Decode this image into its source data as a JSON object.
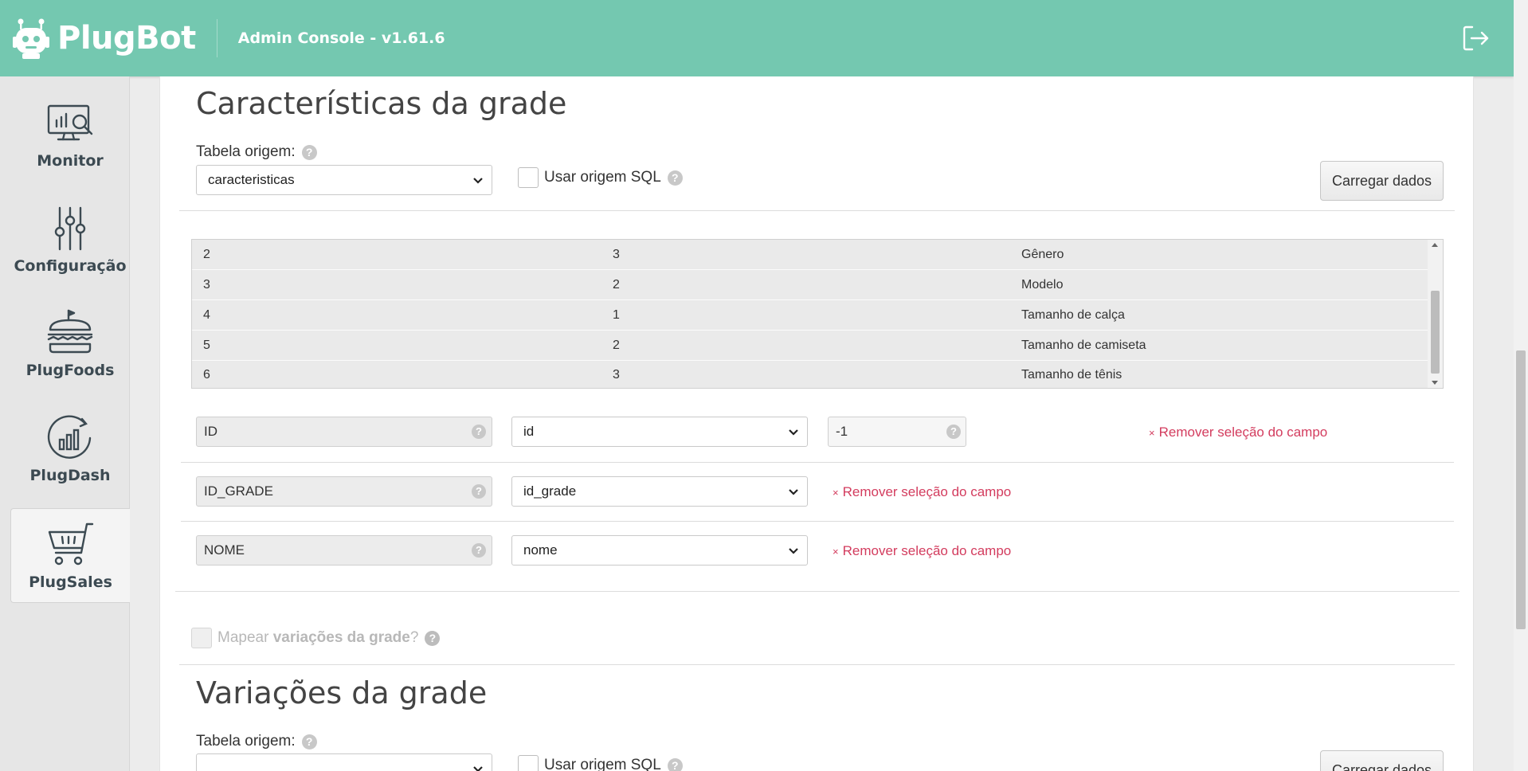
{
  "header": {
    "app_name": "PlugBot",
    "title": "Admin Console - v1.61.6",
    "logo_icon": "robot-icon",
    "logout_icon": "logout-icon"
  },
  "sidebar": {
    "items": [
      {
        "label": "Monitor",
        "icon": "monitor-icon"
      },
      {
        "label": "Configuração",
        "icon": "sliders-icon"
      },
      {
        "label": "PlugFoods",
        "icon": "burger-icon"
      },
      {
        "label": "PlugDash",
        "icon": "chart-icon"
      },
      {
        "label": "PlugSales",
        "icon": "cart-icon",
        "active": true
      }
    ]
  },
  "caracteristicas": {
    "title": "Características da grade",
    "tabela_label": "Tabela origem:",
    "tabela_value": "caracteristicas",
    "sql_label": "Usar origem SQL",
    "load_button": "Carregar dados",
    "rows": [
      {
        "c1": "2",
        "c2": "3",
        "c3": "Gênero"
      },
      {
        "c1": "3",
        "c2": "2",
        "c3": "Modelo"
      },
      {
        "c1": "4",
        "c2": "1",
        "c3": "Tamanho de calça"
      },
      {
        "c1": "5",
        "c2": "2",
        "c3": "Tamanho de camiseta"
      },
      {
        "c1": "6",
        "c2": "3",
        "c3": "Tamanho de tênis"
      }
    ],
    "fields": [
      {
        "name": "ID",
        "select": "id",
        "default": "-1",
        "remove": "Remover seleção do campo"
      },
      {
        "name": "ID_GRADE",
        "select": "id_grade",
        "remove": "Remover seleção do campo"
      },
      {
        "name": "NOME",
        "select": "nome",
        "remove": "Remover seleção do campo"
      }
    ]
  },
  "mapear": {
    "prefix": "Mapear ",
    "bold": "variações da grade",
    "suffix": "?"
  },
  "variacoes": {
    "title": "Variações da grade",
    "tabela_label": "Tabela origem:",
    "tabela_value": "",
    "sql_label": "Usar origem SQL",
    "load_button": "Carregar dados"
  },
  "colors": {
    "header": "#74c8b0",
    "remove": "#d33c5e"
  }
}
